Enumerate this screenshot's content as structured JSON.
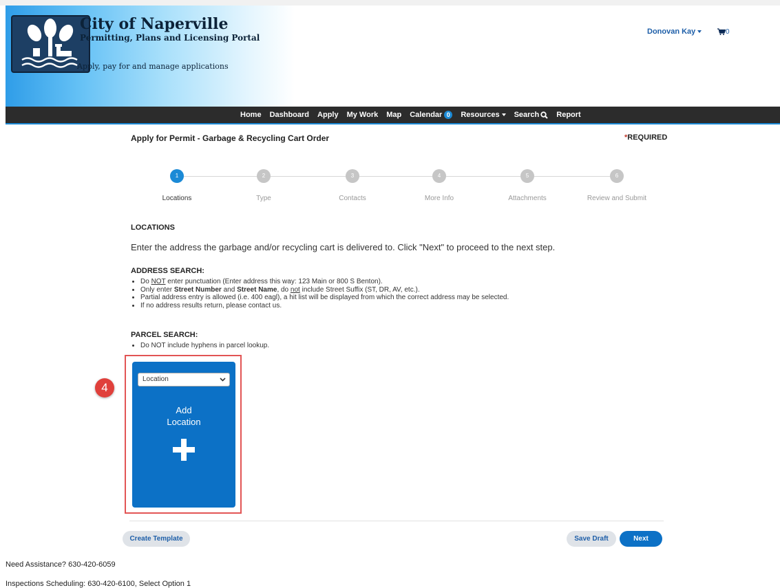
{
  "header": {
    "title": "City of Naperville",
    "subtitle": "Permitting, Plans and Licensing Portal",
    "tagline": "Apply, pay for and manage applications",
    "user_name": "Donovan Kay",
    "cart_count": "0"
  },
  "nav": {
    "items": [
      "Home",
      "Dashboard",
      "Apply",
      "My Work",
      "Map",
      "Calendar",
      "Resources",
      "Search",
      "Report"
    ],
    "calendar_badge": "0"
  },
  "page": {
    "title": "Apply for Permit - Garbage & Recycling Cart Order",
    "required_star": "*",
    "required_label": "REQUIRED"
  },
  "steps": [
    {
      "num": "1",
      "label": "Locations",
      "active": true
    },
    {
      "num": "2",
      "label": "Type",
      "active": false
    },
    {
      "num": "3",
      "label": "Contacts",
      "active": false
    },
    {
      "num": "4",
      "label": "More Info",
      "active": false
    },
    {
      "num": "5",
      "label": "Attachments",
      "active": false
    },
    {
      "num": "6",
      "label": "Review and Submit",
      "active": false
    }
  ],
  "content": {
    "locations_heading": "LOCATIONS",
    "intro": "Enter the address the garbage and/or recycling cart is delivered to. Click \"Next\" to proceed to the next step.",
    "address_heading": "ADDRESS SEARCH:",
    "address_bullets": {
      "b1_a": "Do ",
      "b1_not": "NOT",
      "b1_b": " enter punctuation (Enter address this way: 123 Main or 800 S Benton).",
      "b2_a": "Only enter ",
      "b2_street_number": "Street Number",
      "b2_and": " and ",
      "b2_street_name": "Street Name",
      "b2_b": ", do ",
      "b2_not": "not",
      "b2_c": " include Street Suffix (ST, DR, AV, etc.).",
      "b3": "Partial address entry is allowed (i.e. 400 eagl), a hit list will be displayed from which the correct address may be selected.",
      "b4": "If no address results return, please contact us."
    },
    "parcel_heading": "PARCEL SEARCH:",
    "parcel_bullets": [
      "Do NOT include hyphens in parcel lookup."
    ]
  },
  "location_card": {
    "select_value": "Location",
    "add_label_line1": "Add",
    "add_label_line2": "Location"
  },
  "callout": {
    "number": "4",
    "color": "#e0403b"
  },
  "buttons": {
    "create_template": "Create Template",
    "save_draft": "Save Draft",
    "next": "Next"
  },
  "footer": {
    "assistance": "Need Assistance? 630-420-6059",
    "inspections": "Inspections Scheduling: 630-420-6100, Select Option 1"
  },
  "colors": {
    "brand_blue": "#0c71c6",
    "nav_bg": "#2c2c2c",
    "accent": "#1b8ad6"
  }
}
